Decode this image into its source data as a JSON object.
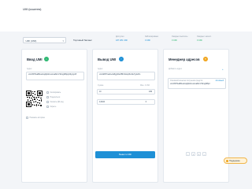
{
  "header": {
    "title": "UMI (кошелек)"
  },
  "wallet": {
    "selected": "UMI (UMI)"
  },
  "balance": {
    "label": "Торговый баланс"
  },
  "stats": [
    {
      "label": "Доступно",
      "value": "187 281 UMI",
      "color": "#1e90d6"
    },
    {
      "label": "Заблокировано",
      "value": "0 UMI",
      "color": "#1e90d6"
    },
    {
      "label": "Ожидает выплаты",
      "value": "0 UMI",
      "color": "#2eb872"
    },
    {
      "label": "Ожидает зачисл.",
      "value": "0 UMI",
      "color": "#2eb872"
    }
  ],
  "deposit": {
    "title": "Ввод UMI",
    "field_label": "Адрес",
    "address": "umi1h87fea89ve2xqdj4nkmuvsxa8cm74tmg4l8pdy4hycgnr8",
    "options": [
      "Скопировать",
      "Поделиться",
      "Скачать QR-код",
      "Скрыть"
    ],
    "history_label": "Показать историю"
  },
  "withdraw": {
    "title": "Вывод UMI",
    "address_label": "Адрес",
    "address_value": "umi1k87fma2ne4s8yjp0tw3l5hr2dxqz6cv9e7g1uf4n",
    "amount_label": "Сумма",
    "amount_hint": "Мин. 1 UMI",
    "amount_value": "10",
    "amount_currency": "UMI",
    "fee_value": "0,0024",
    "fee_currency": "0",
    "submit_label": "Вывести UMI"
  },
  "addresses": {
    "title": "Менеджер адресов",
    "add_label": "Добавить адрес",
    "item_label": "Основной кошелек получения средств",
    "item_tag": "Активный",
    "item_address": "umi1h87fea89ve2xqdj4nkmuvsxa8cm74tmg4l8pd",
    "pager": [
      "‹",
      "1",
      "2",
      "›"
    ]
  },
  "help": {
    "label": "Поддержка"
  }
}
